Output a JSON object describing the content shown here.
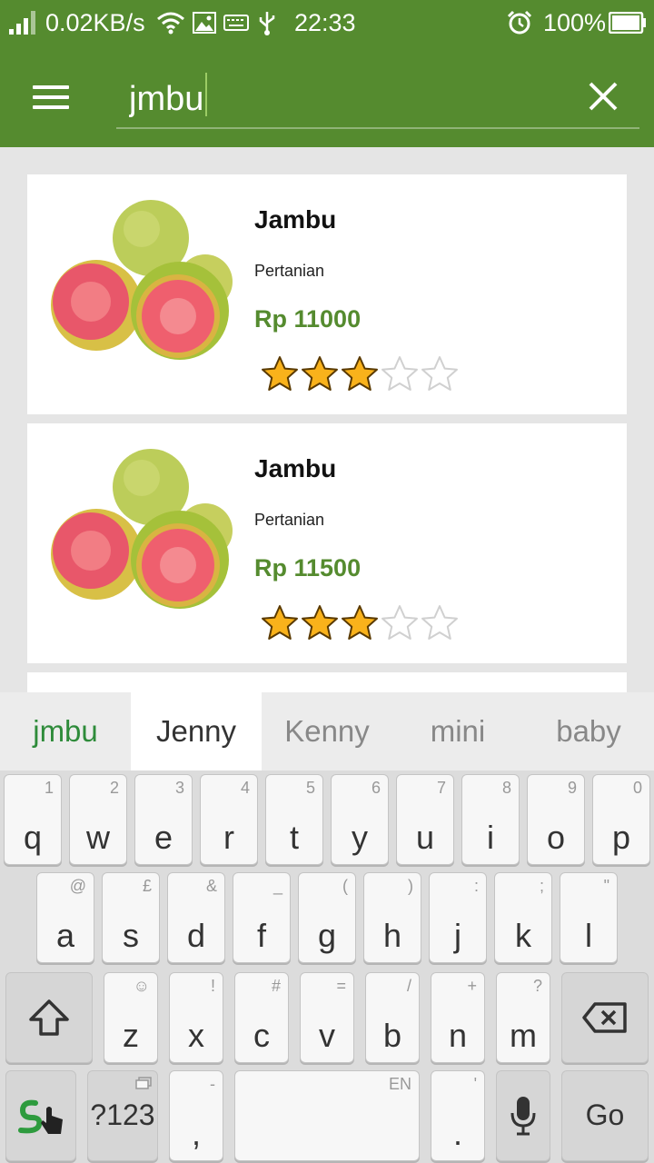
{
  "status_bar": {
    "network_speed": "0.02KB/s",
    "time": "22:33",
    "battery": "100%",
    "icons": [
      "signal-icon",
      "wifi-icon",
      "image-icon",
      "keyboard-icon",
      "usb-icon",
      "alarm-icon",
      "battery-icon"
    ]
  },
  "appbar": {
    "search_value": "jmbu",
    "icons": [
      "menu-icon",
      "close-icon"
    ]
  },
  "products": [
    {
      "name": "Jambu",
      "category": "Pertanian",
      "price": "Rp 11000",
      "rating": 3,
      "rating_max": 5
    },
    {
      "name": "Jambu",
      "category": "Pertanian",
      "price": "Rp 11500",
      "rating": 3,
      "rating_max": 5
    }
  ],
  "colors": {
    "primary": "#558b2f",
    "price": "#558b2f",
    "star": "#f9b21b"
  },
  "keyboard": {
    "suggestions": [
      "jmbu",
      "Jenny",
      "Kenny",
      "mini",
      "baby"
    ],
    "row1": [
      {
        "k": "q",
        "h": "1"
      },
      {
        "k": "w",
        "h": "2"
      },
      {
        "k": "e",
        "h": "3"
      },
      {
        "k": "r",
        "h": "4"
      },
      {
        "k": "t",
        "h": "5"
      },
      {
        "k": "y",
        "h": "6"
      },
      {
        "k": "u",
        "h": "7"
      },
      {
        "k": "i",
        "h": "8"
      },
      {
        "k": "o",
        "h": "9"
      },
      {
        "k": "p",
        "h": "0"
      }
    ],
    "row2": [
      {
        "k": "a",
        "h": "@"
      },
      {
        "k": "s",
        "h": "£"
      },
      {
        "k": "d",
        "h": "&"
      },
      {
        "k": "f",
        "h": "_"
      },
      {
        "k": "g",
        "h": "("
      },
      {
        "k": "h",
        "h": ")"
      },
      {
        "k": "j",
        "h": ":"
      },
      {
        "k": "k",
        "h": ";"
      },
      {
        "k": "l",
        "h": "\""
      }
    ],
    "row3": [
      {
        "k": "z",
        "h": "☺"
      },
      {
        "k": "x",
        "h": "!"
      },
      {
        "k": "c",
        "h": "#"
      },
      {
        "k": "v",
        "h": "="
      },
      {
        "k": "b",
        "h": "/"
      },
      {
        "k": "n",
        "h": "+"
      },
      {
        "k": "m",
        "h": "?"
      }
    ],
    "numbers_label": "?123",
    "comma": ",",
    "comma_hint": "-",
    "space_hint": "EN",
    "period": ".",
    "period_hint": "'",
    "go_label": "Go"
  }
}
